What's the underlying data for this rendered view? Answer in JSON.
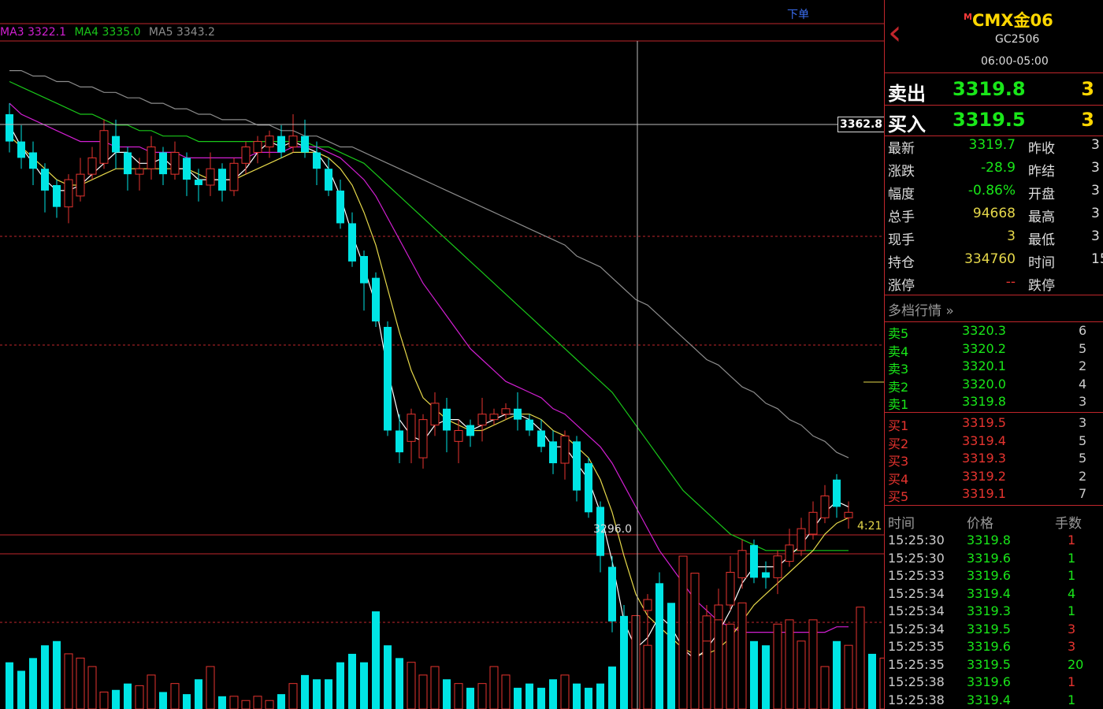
{
  "colors": {
    "up": "#e6342f",
    "down": "#00e5e5",
    "ma1": "#ffffff",
    "ma2": "#e6d84a",
    "ma3": "#d21fd2",
    "ma4": "#19c619",
    "ma5": "#8c8c8c",
    "grid": "#c0262b",
    "sell": "#19e619",
    "buy": "#e6342f",
    "accent": "#ffd700"
  },
  "chart": {
    "ma_legend": [
      {
        "text": "MA3 3322.1",
        "color": "#d21fd2"
      },
      {
        "text": "MA4 3335.0",
        "color": "#19c619"
      },
      {
        "text": "MA5 3343.2",
        "color": "#8c8c8c"
      }
    ],
    "order_button": "下单",
    "crosshair_price": "3362.8",
    "low_label": "3296.0",
    "time_left": "4:21"
  },
  "chart_data": {
    "type": "candlestick",
    "price_range": [
      3291,
      3381
    ],
    "candles": [
      [
        3368,
        3363,
        3370,
        3361
      ],
      [
        3363,
        3360,
        3366,
        3358
      ],
      [
        3361,
        3358,
        3363,
        3355
      ],
      [
        3358,
        3354,
        3359,
        3350
      ],
      [
        3355,
        3351,
        3356,
        3349
      ],
      [
        3351,
        3356,
        3357,
        3348
      ],
      [
        3353,
        3357,
        3360,
        3352
      ],
      [
        3357,
        3360,
        3362,
        3356
      ],
      [
        3359,
        3365,
        3367,
        3358
      ],
      [
        3364,
        3361,
        3367,
        3358
      ],
      [
        3361,
        3357,
        3362,
        3354
      ],
      [
        3357,
        3358,
        3360,
        3354
      ],
      [
        3358,
        3362,
        3364,
        3356
      ],
      [
        3361,
        3357,
        3362,
        3355
      ],
      [
        3357,
        3361,
        3363,
        3356
      ],
      [
        3360,
        3356,
        3361,
        3353
      ],
      [
        3356,
        3355,
        3358,
        3352
      ],
      [
        3355,
        3358,
        3361,
        3353
      ],
      [
        3358,
        3354,
        3359,
        3352
      ],
      [
        3354,
        3359,
        3360,
        3353
      ],
      [
        3359,
        3362,
        3363,
        3357
      ],
      [
        3361,
        3363,
        3364,
        3359
      ],
      [
        3362,
        3364,
        3365,
        3360
      ],
      [
        3364,
        3361,
        3366,
        3360
      ],
      [
        3362,
        3364,
        3368,
        3361
      ],
      [
        3364,
        3361,
        3367,
        3360
      ],
      [
        3361,
        3358,
        3363,
        3355
      ],
      [
        3358,
        3354,
        3360,
        3353
      ],
      [
        3354,
        3348,
        3356,
        3347
      ],
      [
        3348,
        3341,
        3350,
        3340
      ],
      [
        3342,
        3337,
        3343,
        3332
      ],
      [
        3338,
        3330,
        3339,
        3329
      ],
      [
        3329,
        3310,
        3330,
        3309
      ],
      [
        3310,
        3306,
        3313,
        3304
      ],
      [
        3308,
        3313,
        3314,
        3304
      ],
      [
        3305,
        3312,
        3313,
        3303
      ],
      [
        3311,
        3315,
        3317,
        3309
      ],
      [
        3314,
        3310,
        3316,
        3306
      ],
      [
        3308,
        3310,
        3312,
        3304
      ],
      [
        3311,
        3309,
        3312,
        3307
      ],
      [
        3311,
        3313,
        3316,
        3308
      ],
      [
        3312,
        3313,
        3314,
        3311
      ],
      [
        3313,
        3314,
        3315,
        3312
      ],
      [
        3314,
        3312,
        3317,
        3310
      ],
      [
        3312,
        3310,
        3313,
        3309
      ],
      [
        3310,
        3307,
        3312,
        3306
      ],
      [
        3308,
        3304,
        3310,
        3302
      ],
      [
        3304,
        3309,
        3310,
        3301
      ],
      [
        3308,
        3299,
        3309,
        3297
      ],
      [
        3304,
        3295,
        3305,
        3294
      ],
      [
        3296,
        3287,
        3297,
        3284
      ],
      [
        3285,
        3275,
        3287,
        3273
      ],
      [
        3276,
        3262,
        3278,
        3260
      ],
      [
        3264,
        3275,
        3276,
        3261
      ],
      [
        3277,
        3279,
        3280,
        3266
      ],
      [
        3282,
        3272,
        3284,
        3267
      ],
      [
        3273,
        3266,
        3274,
        3264
      ],
      [
        3266,
        3272,
        3276,
        3263
      ],
      [
        3270,
        3272,
        3273,
        3267
      ],
      [
        3271,
        3276,
        3278,
        3268
      ],
      [
        3274,
        3278,
        3281,
        3272
      ],
      [
        3278,
        3284,
        3287,
        3277
      ],
      [
        3283,
        3288,
        3290,
        3281
      ],
      [
        3289,
        3283,
        3290,
        3282
      ],
      [
        3284,
        3283,
        3286,
        3281
      ],
      [
        3283,
        3287,
        3288,
        3280
      ],
      [
        3286,
        3289,
        3292,
        3285
      ],
      [
        3288,
        3292,
        3294,
        3287
      ],
      [
        3291,
        3295,
        3297,
        3290
      ],
      [
        3294,
        3298,
        3300,
        3293
      ],
      [
        3301,
        3296,
        3302,
        3294
      ],
      [
        3294,
        3295,
        3297,
        3292
      ]
    ],
    "volume": [
      22,
      18,
      24,
      30,
      32,
      26,
      24,
      20,
      8,
      9,
      12,
      11,
      16,
      8,
      12,
      7,
      14,
      20,
      6,
      6,
      4,
      6,
      4,
      7,
      12,
      16,
      14,
      14,
      22,
      26,
      22,
      46,
      30,
      24,
      22,
      16,
      20,
      14,
      12,
      10,
      12,
      20,
      16,
      10,
      12,
      10,
      14,
      16,
      12,
      10,
      12,
      20,
      18,
      44,
      30,
      38,
      50,
      72,
      64,
      32,
      42,
      40,
      50,
      32,
      30,
      40,
      42,
      32,
      42,
      20,
      32,
      30,
      48,
      26,
      24,
      14,
      40,
      20,
      32,
      22
    ],
    "ma_lines": [
      {
        "name": "MA1",
        "color": "#ffffff",
        "values": [
          3366,
          3362,
          3359,
          3356,
          3354,
          3354,
          3355,
          3357,
          3359,
          3361,
          3361,
          3359,
          3359,
          3360,
          3358,
          3358,
          3356,
          3356,
          3356,
          3356,
          3358,
          3361,
          3363,
          3362,
          3363,
          3362,
          3361,
          3358,
          3353,
          3346,
          3340,
          3333,
          3321,
          3312,
          3309,
          3308,
          3311,
          3312,
          3312,
          3310,
          3311,
          3312,
          3313,
          3313,
          3312,
          3310,
          3307,
          3307,
          3304,
          3301,
          3295,
          3286,
          3275,
          3270,
          3272,
          3276,
          3274,
          3270,
          3268,
          3270,
          3273,
          3277,
          3282,
          3285,
          3285,
          3285,
          3287,
          3289,
          3292,
          3295,
          3297,
          3296
        ]
      },
      {
        "name": "MA2",
        "color": "#e6d84a",
        "values": [
          3364,
          3362,
          3360,
          3358,
          3356,
          3355,
          3355,
          3356,
          3357,
          3358,
          3358,
          3358,
          3358,
          3358,
          3358,
          3358,
          3357,
          3356,
          3356,
          3356,
          3357,
          3358,
          3359,
          3360,
          3361,
          3361,
          3361,
          3360,
          3358,
          3355,
          3350,
          3344,
          3336,
          3328,
          3321,
          3316,
          3314,
          3312,
          3311,
          3310,
          3310,
          3311,
          3312,
          3313,
          3313,
          3312,
          3310,
          3309,
          3307,
          3305,
          3301,
          3295,
          3287,
          3280,
          3276,
          3274,
          3272,
          3270,
          3269,
          3269,
          3270,
          3272,
          3275,
          3278,
          3280,
          3282,
          3284,
          3286,
          3288,
          3291,
          3293,
          3294
        ]
      },
      {
        "name": "MA3",
        "color": "#d21fd2",
        "values": [
          3370,
          3368,
          3367,
          3366,
          3365,
          3364,
          3363,
          3363,
          3363,
          3362,
          3362,
          3362,
          3361,
          3361,
          3361,
          3360,
          3360,
          3360,
          3360,
          3360,
          3360,
          3361,
          3361,
          3361,
          3362,
          3362,
          3362,
          3361,
          3360,
          3358,
          3356,
          3353,
          3349,
          3345,
          3341,
          3337,
          3334,
          3331,
          3328,
          3325,
          3323,
          3321,
          3319,
          3318,
          3317,
          3316,
          3314,
          3313,
          3311,
          3309,
          3307,
          3304,
          3300,
          3296,
          3292,
          3288,
          3285,
          3282,
          3279,
          3277,
          3275,
          3274,
          3273,
          3273,
          3273,
          3273,
          3273,
          3273,
          3273,
          3273,
          3274,
          3274
        ]
      },
      {
        "name": "MA4",
        "color": "#19c619",
        "values": [
          3374,
          3373,
          3372,
          3371,
          3370,
          3369,
          3368,
          3368,
          3367,
          3366,
          3366,
          3365,
          3365,
          3364,
          3364,
          3364,
          3363,
          3363,
          3363,
          3363,
          3363,
          3363,
          3363,
          3363,
          3363,
          3363,
          3362,
          3362,
          3361,
          3360,
          3359,
          3357,
          3355,
          3353,
          3351,
          3349,
          3347,
          3345,
          3343,
          3341,
          3339,
          3337,
          3335,
          3333,
          3331,
          3329,
          3327,
          3325,
          3323,
          3321,
          3319,
          3317,
          3314,
          3311,
          3308,
          3305,
          3302,
          3299,
          3297,
          3295,
          3293,
          3291,
          3290,
          3289,
          3288,
          3288,
          3288,
          3288,
          3288,
          3288,
          3288,
          3288
        ]
      },
      {
        "name": "MA5",
        "color": "#8c8c8c",
        "values": [
          3376,
          3376,
          3375,
          3375,
          3374,
          3374,
          3373,
          3373,
          3372,
          3372,
          3371,
          3371,
          3370,
          3370,
          3369,
          3369,
          3368,
          3368,
          3367,
          3367,
          3367,
          3366,
          3366,
          3365,
          3365,
          3364,
          3364,
          3363,
          3362,
          3362,
          3361,
          3360,
          3359,
          3358,
          3357,
          3356,
          3355,
          3354,
          3353,
          3352,
          3351,
          3350,
          3349,
          3348,
          3347,
          3346,
          3345,
          3344,
          3342,
          3341,
          3340,
          3338,
          3336,
          3334,
          3333,
          3331,
          3329,
          3327,
          3325,
          3323,
          3322,
          3320,
          3318,
          3317,
          3315,
          3314,
          3312,
          3311,
          3309,
          3308,
          3306,
          3305
        ]
      }
    ]
  },
  "side": {
    "back_icon": "‹",
    "title": "CMX金06",
    "title_mark": "M",
    "code": "GC2506",
    "session": "06:00-05:00",
    "sell": {
      "label": "卖出",
      "price": "3319.8",
      "qty": "3"
    },
    "buy": {
      "label": "买入",
      "price": "3319.5",
      "qty": "3"
    },
    "stats": [
      {
        "k1": "最新",
        "v1": "3319.7",
        "c1": "#19e619",
        "k2": "昨收",
        "v2": "3"
      },
      {
        "k1": "涨跌",
        "v1": "-28.9",
        "c1": "#19e619",
        "k2": "昨结",
        "v2": "3"
      },
      {
        "k1": "幅度",
        "v1": "-0.86%",
        "c1": "#19e619",
        "k2": "开盘",
        "v2": "3"
      },
      {
        "k1": "总手",
        "v1": "94668",
        "c1": "#e6d84a",
        "k2": "最高",
        "v2": "3"
      },
      {
        "k1": "现手",
        "v1": "3",
        "c1": "#e6d84a",
        "k2": "最低",
        "v2": "3"
      },
      {
        "k1": "持仓",
        "v1": "334760",
        "c1": "#e6d84a",
        "k2": "时间",
        "v2": "15:"
      },
      {
        "k1": "涨停",
        "v1": "--",
        "c1": "#e6342f",
        "k2": "跌停",
        "v2": ""
      }
    ],
    "depth_title": "多档行情",
    "asks": [
      {
        "k": "卖5",
        "p": "3320.3",
        "q": "6"
      },
      {
        "k": "卖4",
        "p": "3320.2",
        "q": "5"
      },
      {
        "k": "卖3",
        "p": "3320.1",
        "q": "2"
      },
      {
        "k": "卖2",
        "p": "3320.0",
        "q": "4"
      },
      {
        "k": "卖1",
        "p": "3319.8",
        "q": "3"
      }
    ],
    "bids": [
      {
        "k": "买1",
        "p": "3319.5",
        "q": "3"
      },
      {
        "k": "买2",
        "p": "3319.4",
        "q": "5"
      },
      {
        "k": "买3",
        "p": "3319.3",
        "q": "5"
      },
      {
        "k": "买4",
        "p": "3319.2",
        "q": "2"
      },
      {
        "k": "买5",
        "p": "3319.1",
        "q": "7"
      }
    ],
    "ticks_header": {
      "time": "时间",
      "price": "价格",
      "qty": "手数"
    },
    "ticks": [
      {
        "t": "15:25:30",
        "p": "3319.8",
        "q": "1",
        "c": "#e6342f"
      },
      {
        "t": "15:25:30",
        "p": "3319.6",
        "q": "1",
        "c": "#19e619"
      },
      {
        "t": "15:25:33",
        "p": "3319.6",
        "q": "1",
        "c": "#19e619"
      },
      {
        "t": "15:25:34",
        "p": "3319.4",
        "q": "4",
        "c": "#19e619"
      },
      {
        "t": "15:25:34",
        "p": "3319.3",
        "q": "1",
        "c": "#19e619"
      },
      {
        "t": "15:25:34",
        "p": "3319.5",
        "q": "3",
        "c": "#e6342f"
      },
      {
        "t": "15:25:35",
        "p": "3319.6",
        "q": "3",
        "c": "#e6342f"
      },
      {
        "t": "15:25:35",
        "p": "3319.5",
        "q": "20",
        "c": "#19e619"
      },
      {
        "t": "15:25:38",
        "p": "3319.6",
        "q": "1",
        "c": "#e6342f"
      },
      {
        "t": "15:25:38",
        "p": "3319.4",
        "q": "1",
        "c": "#19e619"
      }
    ]
  }
}
